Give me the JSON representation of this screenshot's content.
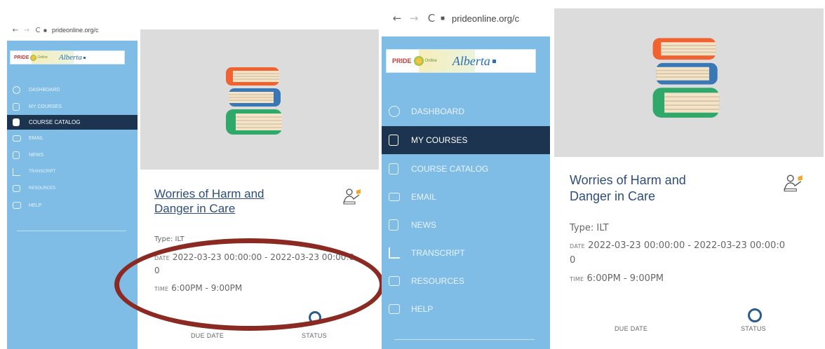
{
  "browser": {
    "back_icon": "←",
    "forward_icon": "→",
    "reload_icon": "C",
    "lock_icon": "🔒",
    "url": "prideonline.org/c"
  },
  "logo": {
    "pride": "PRIDE",
    "online": "Online",
    "alberta": "Alberta"
  },
  "menu": {
    "items": [
      {
        "label": "DASHBOARD",
        "icon": "dashboard-icon"
      },
      {
        "label": "MY COURSES",
        "icon": "my-courses-icon"
      },
      {
        "label": "COURSE CATALOG",
        "icon": "course-catalog-icon"
      },
      {
        "label": "EMAIL",
        "icon": "email-icon"
      },
      {
        "label": "NEWS",
        "icon": "news-icon"
      },
      {
        "label": "TRANSCRIPT",
        "icon": "transcript-icon"
      },
      {
        "label": "RESOURCES",
        "icon": "resources-icon"
      },
      {
        "label": "HELP",
        "icon": "help-icon"
      }
    ],
    "panel1_active": "COURSE CATALOG",
    "panel3_active": "MY COURSES",
    "panel3_labels": [
      "DASHBOARD",
      "MY COURSES",
      "COURSE CATALOG",
      "EMAIL",
      "NEWS",
      "TRANSCRIPT",
      "RESOURCES",
      "HELP"
    ]
  },
  "course": {
    "title_line1": "Worries of Harm and",
    "title_line2": "Danger in Care",
    "type": "Type: ILT",
    "date_label": "DATE",
    "date_value": "2022-03-23 00:00:00 - 2022-03-23 00:00:0",
    "date_wrap": "0",
    "time_label": "TIME",
    "time_value": "6:00PM - 9:00PM",
    "due_date_label": "DUE DATE",
    "status_label": "STATUS"
  },
  "colors": {
    "sidebar": "#7fbce6",
    "active_item": "#1c3450",
    "title": "#2d4d7a",
    "annotation": "#8a2a22",
    "status_ring": "#2a5c8f"
  }
}
